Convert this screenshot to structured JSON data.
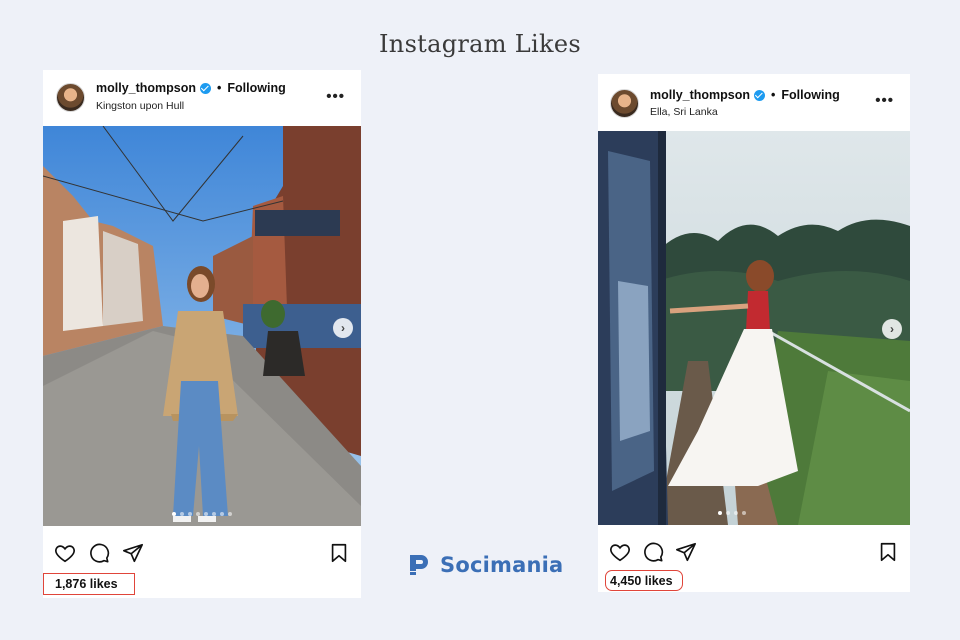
{
  "page": {
    "title": "Instagram Likes"
  },
  "posts": [
    {
      "username": "molly_thompson",
      "following": "Following",
      "location": "Kingston upon Hull",
      "more": "•••",
      "likes": "1,876 likes"
    },
    {
      "username": "molly_thompson",
      "following": "Following",
      "location": "Ella, Sri Lanka",
      "more": "•••",
      "likes": "4,450 likes"
    }
  ],
  "brand": {
    "name": "Socimania"
  },
  "colors": {
    "background": "#eef1f8",
    "highlight": "#e0453a",
    "brand": "#3b6fb6",
    "verified": "#1d9bf0"
  },
  "icons": [
    "verified-badge-icon",
    "more-options-icon",
    "carousel-next-icon",
    "like-heart-icon",
    "comment-icon",
    "share-icon",
    "save-bookmark-icon",
    "socimania-logo-icon"
  ]
}
